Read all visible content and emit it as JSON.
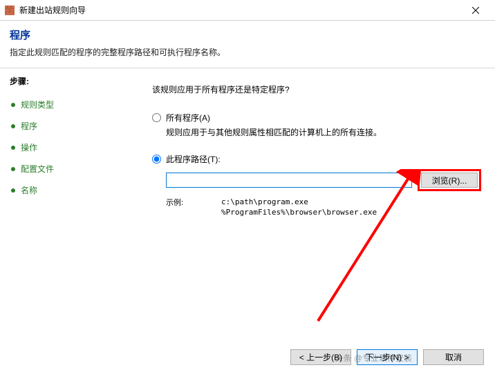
{
  "titlebar": {
    "title": "新建出站规则向导"
  },
  "header": {
    "title": "程序",
    "description": "指定此规则匹配的程序的完整程序路径和可执行程序名称。"
  },
  "sidebar": {
    "steps_title": "步骤:",
    "items": [
      {
        "label": "规则类型"
      },
      {
        "label": "程序"
      },
      {
        "label": "操作"
      },
      {
        "label": "配置文件"
      },
      {
        "label": "名称"
      }
    ]
  },
  "content": {
    "question": "该规则应用于所有程序还是特定程序?",
    "all_programs": {
      "label": "所有程序(A)",
      "description": "规则应用于与其他规则属性相匹配的计算机上的所有连接。"
    },
    "this_program": {
      "label": "此程序路径(T):",
      "path_value": "",
      "browse_label": "浏览(R)...",
      "example_label": "示例:",
      "example_paths": "c:\\path\\program.exe\n%ProgramFiles%\\browser\\browser.exe"
    }
  },
  "footer": {
    "back_label": "< 上一步(B)",
    "next_label": "下一步(N) >",
    "cancel_label": "取消"
  },
  "watermark": "头条 @专业软件安装"
}
